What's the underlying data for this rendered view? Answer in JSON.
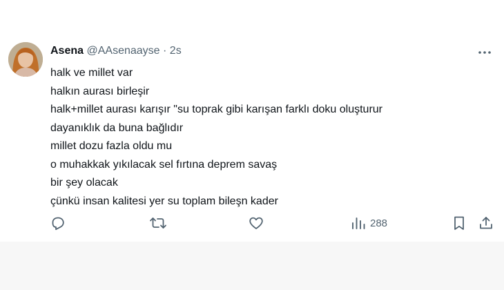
{
  "tweet": {
    "author_name": "Asena",
    "handle": "@AAsenaayse",
    "separator": "·",
    "time": "2s",
    "lines": [
      "halk ve millet var",
      "halkın aurası birleşir",
      "halk+millet aurası karışır \"su toprak gibi karışan farklı doku oluşturur",
      "dayanıklık da buna bağlıdır",
      "millet dozu fazla oldu mu",
      "o muhakkak yıkılacak sel fırtına deprem savaş",
      "bir şey olacak",
      "çünkü insan kalitesi yer su toplam bileşn kader"
    ]
  },
  "actions": {
    "reply_icon": "reply-icon",
    "retweet_icon": "retweet-icon",
    "like_icon": "heart-icon",
    "views_icon": "views-bar-chart-icon",
    "views_count": "288",
    "bookmark_icon": "bookmark-icon",
    "share_icon": "share-icon"
  },
  "colors": {
    "text": "#0f1419",
    "secondary": "#536471",
    "background": "#ffffff",
    "page": "#f7f7f7"
  }
}
